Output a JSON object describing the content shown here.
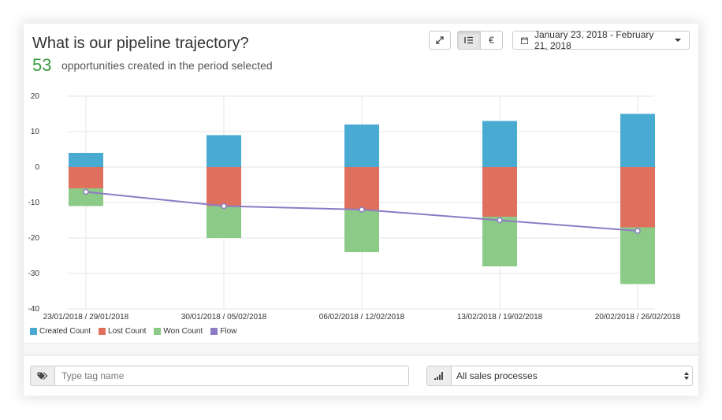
{
  "header": {
    "title": "What is our pipeline trajectory?",
    "count": "53",
    "count_text": "opportunities created in the period selected",
    "date_range": "January 23, 2018 - February 21, 2018",
    "currency_symbol": "€"
  },
  "icons": {
    "expand": "expand-icon",
    "list": "list-icon",
    "calendar": "calendar-icon",
    "tag": "tag-icon",
    "signal": "signal-bars-icon"
  },
  "filters": {
    "tag_placeholder": "Type tag name",
    "sales_process": "All sales processes"
  },
  "chart_data": {
    "type": "bar",
    "stacked": true,
    "categories": [
      "23/01/2018 / 29/01/2018",
      "30/01/2018 / 05/02/2018",
      "06/02/2018 / 12/02/2018",
      "13/02/2018 / 19/02/2018",
      "20/02/2018 / 26/02/2018"
    ],
    "ylim": [
      -40,
      20
    ],
    "yticks": [
      "20",
      "10",
      "0",
      "-10",
      "-20",
      "-30",
      "-40"
    ],
    "grid": true,
    "legend_position": "bottom-left",
    "series": [
      {
        "name": "Created Count",
        "type": "bar",
        "color": "#4aabd2",
        "values": [
          4,
          9,
          12,
          13,
          15
        ]
      },
      {
        "name": "Lost Count",
        "type": "bar",
        "color": "#e0705e",
        "values": [
          -6,
          -11,
          -12,
          -14,
          -17
        ]
      },
      {
        "name": "Won Count",
        "type": "bar",
        "color": "#8cca88",
        "values": [
          -5,
          -9,
          -12,
          -14,
          -16
        ]
      },
      {
        "name": "Flow",
        "type": "line",
        "color": "#8d7bc4",
        "values": [
          -7,
          -11,
          -12,
          -15,
          -18
        ]
      }
    ]
  }
}
